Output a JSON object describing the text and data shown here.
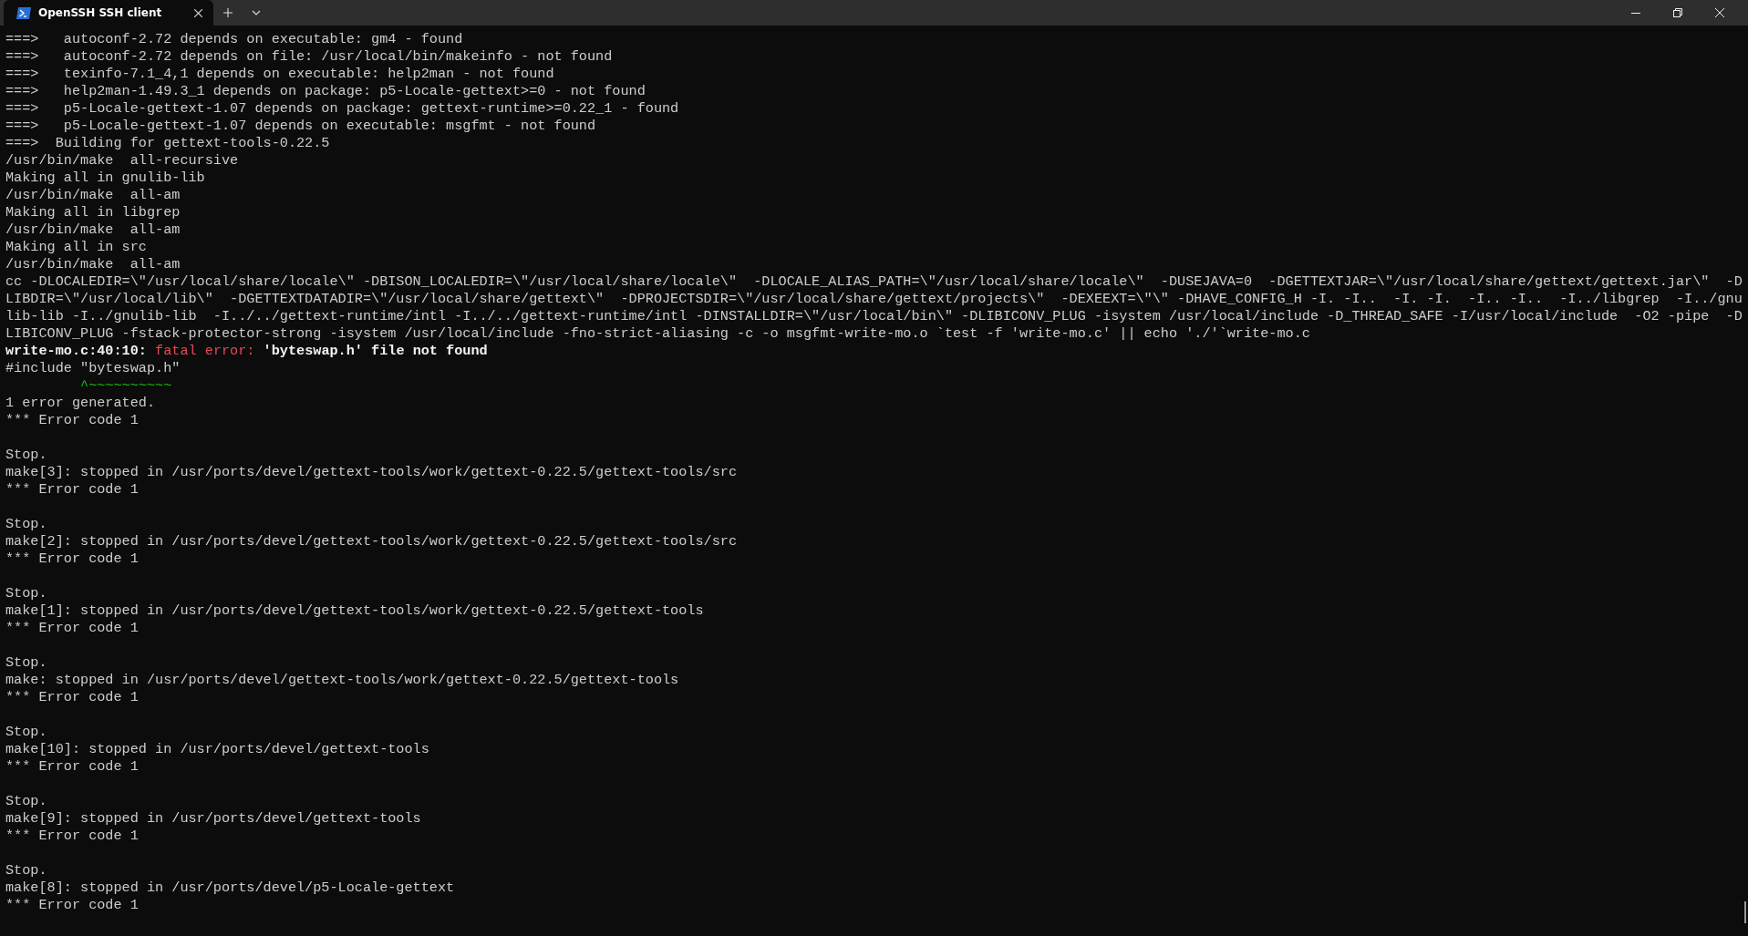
{
  "window": {
    "tab": {
      "title": "OpenSSH SSH client",
      "selected": true
    }
  },
  "terminal": {
    "lines": [
      {
        "kind": "text",
        "text": "===>   autoconf-2.72 depends on executable: gm4 - found"
      },
      {
        "kind": "text",
        "text": "===>   autoconf-2.72 depends on file: /usr/local/bin/makeinfo - not found"
      },
      {
        "kind": "text",
        "text": "===>   texinfo-7.1_4,1 depends on executable: help2man - not found"
      },
      {
        "kind": "text",
        "text": "===>   help2man-1.49.3_1 depends on package: p5-Locale-gettext>=0 - not found"
      },
      {
        "kind": "text",
        "text": "===>   p5-Locale-gettext-1.07 depends on package: gettext-runtime>=0.22_1 - found"
      },
      {
        "kind": "text",
        "text": "===>   p5-Locale-gettext-1.07 depends on executable: msgfmt - not found"
      },
      {
        "kind": "text",
        "text": "===>  Building for gettext-tools-0.22.5"
      },
      {
        "kind": "text",
        "text": "/usr/bin/make  all-recursive"
      },
      {
        "kind": "text",
        "text": "Making all in gnulib-lib"
      },
      {
        "kind": "text",
        "text": "/usr/bin/make  all-am"
      },
      {
        "kind": "text",
        "text": "Making all in libgrep"
      },
      {
        "kind": "text",
        "text": "/usr/bin/make  all-am"
      },
      {
        "kind": "text",
        "text": "Making all in src"
      },
      {
        "kind": "text",
        "text": "/usr/bin/make  all-am"
      },
      {
        "kind": "text",
        "text": "cc -DLOCALEDIR=\\\"/usr/local/share/locale\\\" -DBISON_LOCALEDIR=\\\"/usr/local/share/locale\\\"  -DLOCALE_ALIAS_PATH=\\\"/usr/local/share/locale\\\"  -DUSEJAVA=0  -DGETTEXTJAR=\\\"/usr/local/share/gettext/gettext.jar\\\"  -D"
      },
      {
        "kind": "text",
        "text": "LIBDIR=\\\"/usr/local/lib\\\"  -DGETTEXTDATADIR=\\\"/usr/local/share/gettext\\\"  -DPROJECTSDIR=\\\"/usr/local/share/gettext/projects\\\"  -DEXEEXT=\\\"\\\" -DHAVE_CONFIG_H -I. -I..  -I. -I.  -I.. -I..  -I../libgrep  -I../gnu"
      },
      {
        "kind": "text",
        "text": "lib-lib -I../gnulib-lib  -I../../gettext-runtime/intl -I../../gettext-runtime/intl -DINSTALLDIR=\\\"/usr/local/bin\\\" -DLIBICONV_PLUG -isystem /usr/local/include -D_THREAD_SAFE -I/usr/local/include  -O2 -pipe  -D"
      },
      {
        "kind": "text",
        "text": "LIBICONV_PLUG -fstack-protector-strong -isystem /usr/local/include -fno-strict-aliasing -c -o msgfmt-write-mo.o `test -f 'write-mo.c' || echo './'`write-mo.c"
      },
      {
        "kind": "diagnostic",
        "location": "write-mo.c:40:10:",
        "severity": "fatal error:",
        "message": "'byteswap.h' file not found"
      },
      {
        "kind": "text",
        "text": "#include \"byteswap.h\""
      },
      {
        "kind": "caret",
        "text": "^~~~~~~~~~~"
      },
      {
        "kind": "text",
        "text": "1 error generated."
      },
      {
        "kind": "text",
        "text": "*** Error code 1"
      },
      {
        "kind": "blank"
      },
      {
        "kind": "text",
        "text": "Stop."
      },
      {
        "kind": "text",
        "text": "make[3]: stopped in /usr/ports/devel/gettext-tools/work/gettext-0.22.5/gettext-tools/src"
      },
      {
        "kind": "text",
        "text": "*** Error code 1"
      },
      {
        "kind": "blank"
      },
      {
        "kind": "text",
        "text": "Stop."
      },
      {
        "kind": "text",
        "text": "make[2]: stopped in /usr/ports/devel/gettext-tools/work/gettext-0.22.5/gettext-tools/src"
      },
      {
        "kind": "text",
        "text": "*** Error code 1"
      },
      {
        "kind": "blank"
      },
      {
        "kind": "text",
        "text": "Stop."
      },
      {
        "kind": "text",
        "text": "make[1]: stopped in /usr/ports/devel/gettext-tools/work/gettext-0.22.5/gettext-tools"
      },
      {
        "kind": "text",
        "text": "*** Error code 1"
      },
      {
        "kind": "blank"
      },
      {
        "kind": "text",
        "text": "Stop."
      },
      {
        "kind": "text",
        "text": "make: stopped in /usr/ports/devel/gettext-tools/work/gettext-0.22.5/gettext-tools"
      },
      {
        "kind": "text",
        "text": "*** Error code 1"
      },
      {
        "kind": "blank"
      },
      {
        "kind": "text",
        "text": "Stop."
      },
      {
        "kind": "text",
        "text": "make[10]: stopped in /usr/ports/devel/gettext-tools"
      },
      {
        "kind": "text",
        "text": "*** Error code 1"
      },
      {
        "kind": "blank"
      },
      {
        "kind": "text",
        "text": "Stop."
      },
      {
        "kind": "text",
        "text": "make[9]: stopped in /usr/ports/devel/gettext-tools"
      },
      {
        "kind": "text",
        "text": "*** Error code 1"
      },
      {
        "kind": "blank"
      },
      {
        "kind": "text",
        "text": "Stop."
      },
      {
        "kind": "text",
        "text": "make[8]: stopped in /usr/ports/devel/p5-Locale-gettext"
      },
      {
        "kind": "text",
        "text": "*** Error code 1"
      }
    ]
  }
}
